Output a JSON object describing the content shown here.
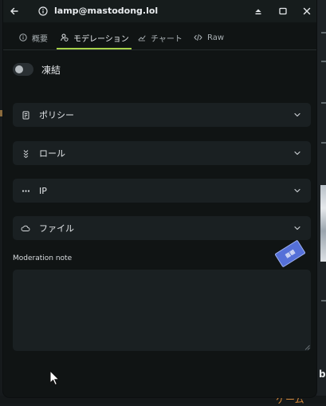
{
  "window": {
    "title": "lamp@mastodong.lol"
  },
  "tabs": [
    {
      "label": "概要",
      "icon": "info-icon",
      "active": false
    },
    {
      "label": "モデレーション",
      "icon": "user-shield-icon",
      "active": true
    },
    {
      "label": "チャート",
      "icon": "chart-icon",
      "active": false
    },
    {
      "label": "Raw",
      "icon": "code-icon",
      "active": false
    }
  ],
  "moderation": {
    "freeze_label": "凍結",
    "freeze_on": false,
    "sections": [
      {
        "label": "ポリシー",
        "icon": "document-icon"
      },
      {
        "label": "ロール",
        "icon": "badge-icon"
      },
      {
        "label": "IP",
        "icon": "dots-icon"
      },
      {
        "label": "ファイル",
        "icon": "cloud-icon"
      }
    ],
    "note_label": "Moderation note",
    "note_value": ""
  },
  "colors": {
    "accent": "#a7d24a",
    "background": "#101414",
    "panel": "#1a2022"
  },
  "background_fragments": {
    "bottom_text": "ゲーム",
    "right_char": "b"
  }
}
